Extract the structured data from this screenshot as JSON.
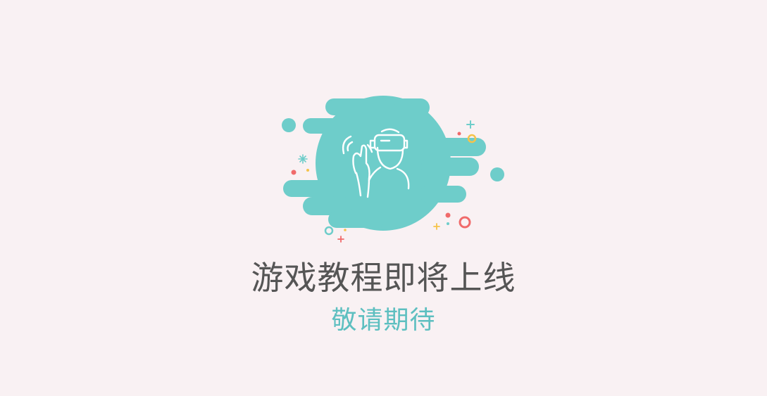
{
  "banner": {
    "title": "游戏教程即将上线",
    "subtitle": "敬请期待"
  },
  "illustration": {
    "icon": "vr-headset-user-icon",
    "splash_color": "#6ecdca",
    "accent_colors": [
      "#f06a6a",
      "#f5c34a",
      "#6ecdca"
    ]
  },
  "colors": {
    "background": "#f9f1f3",
    "title": "#555555",
    "subtitle": "#5dbfc0"
  }
}
